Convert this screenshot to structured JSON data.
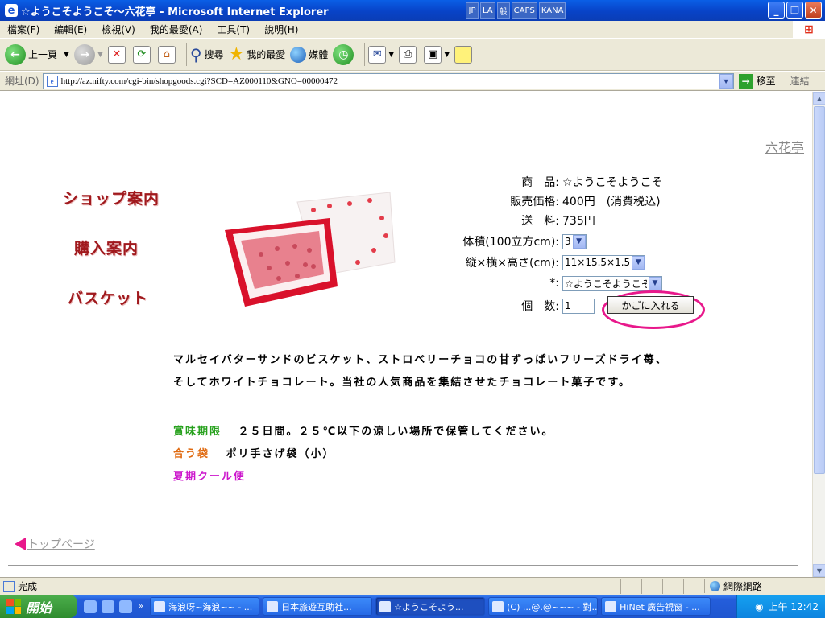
{
  "window": {
    "title": "☆ようこそようこそ〜六花亭 - Microsoft Internet Explorer",
    "ime": [
      "JP",
      "LA",
      "般",
      "CAPS",
      "KANA"
    ]
  },
  "menu": [
    "檔案(F)",
    "編輯(E)",
    "檢視(V)",
    "我的最愛(A)",
    "工具(T)",
    "說明(H)"
  ],
  "toolbar": {
    "back": "上一頁",
    "search": "搜尋",
    "favorites": "我的最愛",
    "media": "媒體"
  },
  "address": {
    "label": "網址(D)",
    "url": "http://az.nifty.com/cgi-bin/shopgoods.cgi?SCD=AZ000110&GNO=00000472",
    "go": "移至",
    "links": "連結"
  },
  "page": {
    "shop_name": "六花亭",
    "nav": [
      "ショップ案内",
      "購入案内",
      "バスケット"
    ],
    "form": {
      "product_label": "商　品:",
      "product_value": "☆ようこそようこそ",
      "price_label": "販売価格:",
      "price_value": "400円　(消費税込)",
      "shipping_label": "送　料:",
      "shipping_value": "735円",
      "volume_label": "体積(100立方cm):",
      "volume_value": "3",
      "dims_label": "縦×横×高さ(cm):",
      "dims_value": "11×15.5×1.5",
      "option_label": "*:",
      "option_value": "☆ようこそようこそ",
      "qty_label": "個　数:",
      "qty_value": "1",
      "cart_button": "かごに入れる"
    },
    "description": [
      "マルセイバターサンドのビスケット、ストロベリーチョコの甘ずっぱいフリーズドライ苺、",
      "そしてホワイトチョコレート。当社の人気商品を集結させたチョコレート菓子です。"
    ],
    "expiry_key": "賞味期限",
    "expiry_value": "２５日間。２５℃以下の涼しい場所で保管してください。",
    "bag_key": "合う袋",
    "bag_value": "ポリ手さげ袋（小）",
    "cool_key": "夏期クール便",
    "top_page": "トップページ"
  },
  "status": {
    "text": "完成",
    "zone": "網際網路"
  },
  "taskbar": {
    "start": "開始",
    "tasks": [
      "海浪呀~海浪~~ - ...",
      "日本旅遊互助社...",
      "☆ようこそよう...",
      "(C) ...@.@~~~ - 對...",
      "HiNet 廣告視窗 - ..."
    ],
    "clock": "上午 12:42"
  },
  "colors": {
    "nav_red": "#a0191d",
    "highlight_pink": "#e8188b",
    "expiry_green": "#27a11d",
    "bag_orange": "#e06a10",
    "cool_magenta": "#cc16cc"
  }
}
